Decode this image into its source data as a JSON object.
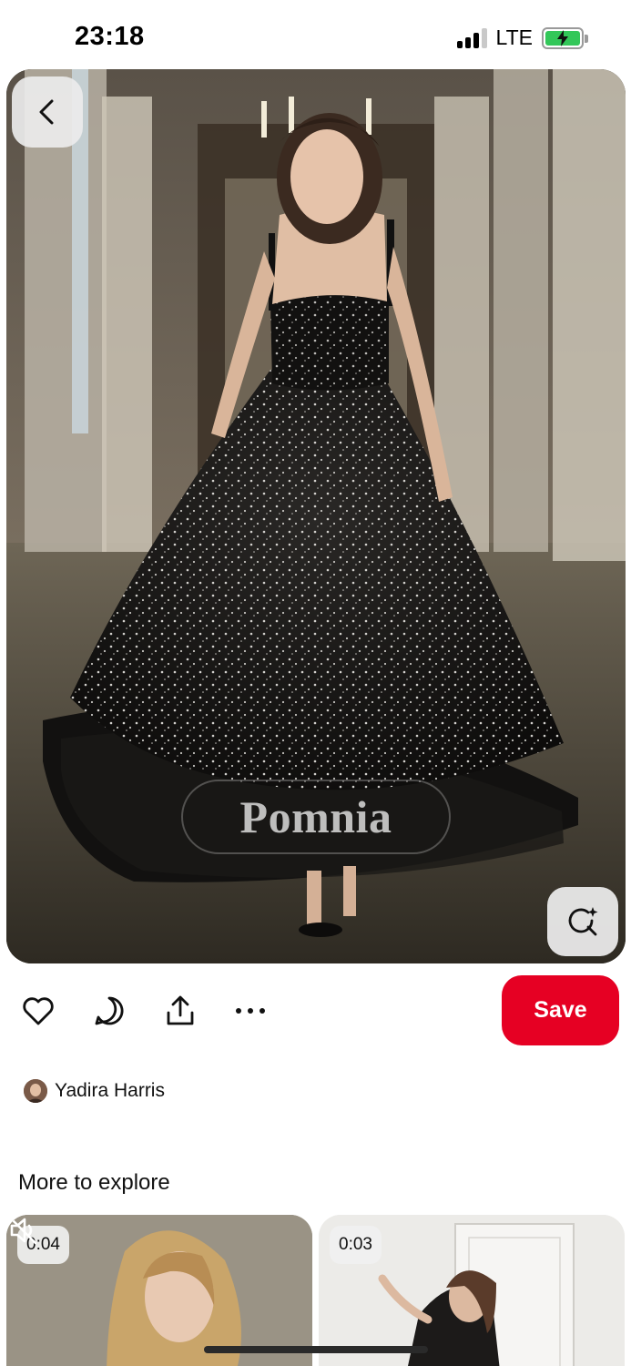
{
  "status_bar": {
    "time": "23:18",
    "network": "LTE",
    "battery_state": "charging",
    "battery_color": "#33c759"
  },
  "pin": {
    "image_description_icon": "dress-photo",
    "watermark_text": "Pomnia",
    "back_icon": "chevron-left-icon",
    "visual_search_icon": "lens-sparkle-icon"
  },
  "actions": {
    "like_icon": "heart-icon",
    "comment_icon": "comment-icon",
    "share_icon": "share-icon",
    "more_icon": "ellipsis-icon",
    "save_label": "Save",
    "save_color": "#e60023"
  },
  "creator": {
    "name": "Yadira Harris"
  },
  "explore": {
    "title": "More to explore",
    "cards": [
      {
        "duration": "0:04",
        "muted": true
      },
      {
        "duration": "0:03",
        "muted": false
      }
    ]
  }
}
